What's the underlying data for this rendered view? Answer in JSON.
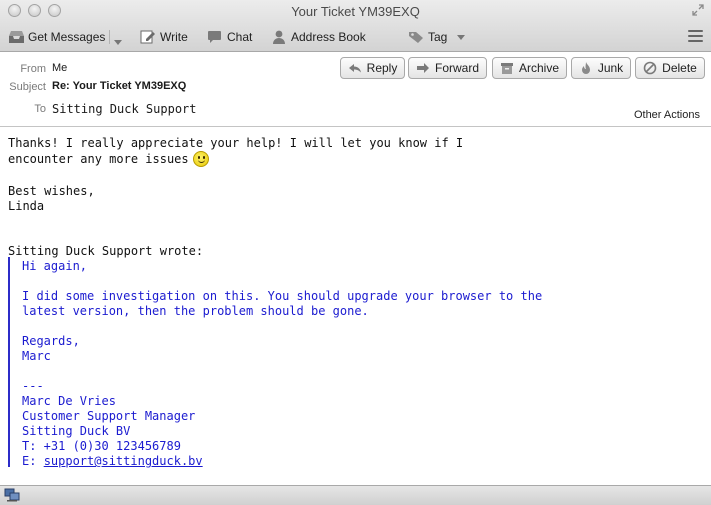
{
  "window": {
    "title": "Your Ticket YM39EXQ"
  },
  "toolbar": {
    "get_messages": "Get Messages",
    "write": "Write",
    "chat": "Chat",
    "address_book": "Address Book",
    "tag": "Tag"
  },
  "header": {
    "from_label": "From",
    "from_value": "Me",
    "subject_label": "Subject",
    "subject_value": "Re: Your Ticket YM39EXQ",
    "to_label": "To",
    "to_value": "Sitting Duck Support",
    "buttons": {
      "reply": "Reply",
      "forward": "Forward",
      "archive": "Archive",
      "junk": "Junk",
      "delete": "Delete"
    },
    "other_actions": "Other Actions"
  },
  "message": {
    "lines": [
      "Thanks! I really appreciate your help! I will let you know if I",
      "encounter any more issues",
      "Best wishes,",
      "Linda",
      "Sitting Duck Support wrote:"
    ],
    "quote": {
      "greeting": "Hi again,",
      "para1": "I did some investigation on this. You should upgrade your browser to the",
      "para2": "latest version, then the problem should be gone.",
      "regards": "Regards,",
      "name": "Marc",
      "sig_sep": "---",
      "sig_name": "Marc De Vries",
      "sig_title": "Customer Support Manager",
      "sig_company": "Sitting Duck BV",
      "sig_phone": "T: +31 (0)30 123456789",
      "sig_email_prefix": "E: ",
      "sig_email": "support@sittingduck.bv"
    }
  },
  "colors": {
    "quote_text": "#1b1bd0",
    "quote_bar": "#2c2cc8",
    "chrome_top": "#ececec",
    "chrome_bottom": "#d3d3d3"
  },
  "icons": {
    "get_messages": "inbox-tray-icon",
    "write": "compose-pencil-icon",
    "chat": "chat-bubble-icon",
    "address_book": "person-icon",
    "tag": "tag-icon",
    "reply": "reply-arrow-icon",
    "forward": "forward-arrow-icon",
    "archive": "archive-box-icon",
    "junk": "junk-flame-icon",
    "delete": "delete-circle-icon",
    "smiley": "smiley-face-icon",
    "status": "network-status-icon"
  }
}
